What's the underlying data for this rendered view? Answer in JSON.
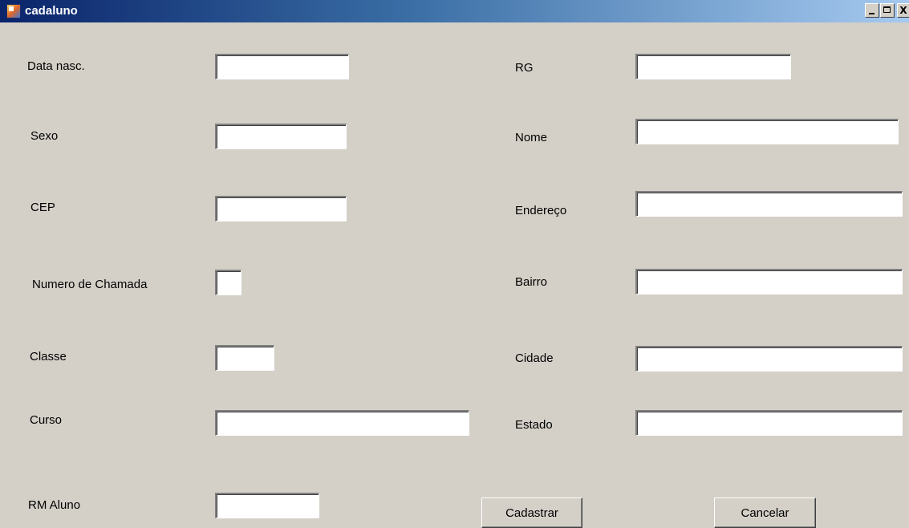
{
  "window": {
    "title": "cadaluno",
    "minimize_glyph": "_",
    "maximize_glyph": "□",
    "close_glyph": "X"
  },
  "form": {
    "left": [
      {
        "label": "Data nasc.",
        "value": ""
      },
      {
        "label": "Sexo",
        "value": ""
      },
      {
        "label": "CEP",
        "value": ""
      },
      {
        "label": "Numero de Chamada",
        "value": ""
      },
      {
        "label": "Classe",
        "value": ""
      },
      {
        "label": "Curso",
        "value": ""
      },
      {
        "label": "RM Aluno",
        "value": ""
      }
    ],
    "right": [
      {
        "label": "RG",
        "value": ""
      },
      {
        "label": "Nome",
        "value": ""
      },
      {
        "label": "Endereço",
        "value": ""
      },
      {
        "label": "Bairro",
        "value": ""
      },
      {
        "label": "Cidade",
        "value": ""
      },
      {
        "label": "Estado",
        "value": ""
      }
    ]
  },
  "buttons": {
    "submit_label": "Cadastrar",
    "cancel_label": "Cancelar"
  },
  "colors": {
    "window_background": "#d4d0c8",
    "titlebar_start": "#0a246a",
    "titlebar_end": "#a6caf0"
  }
}
